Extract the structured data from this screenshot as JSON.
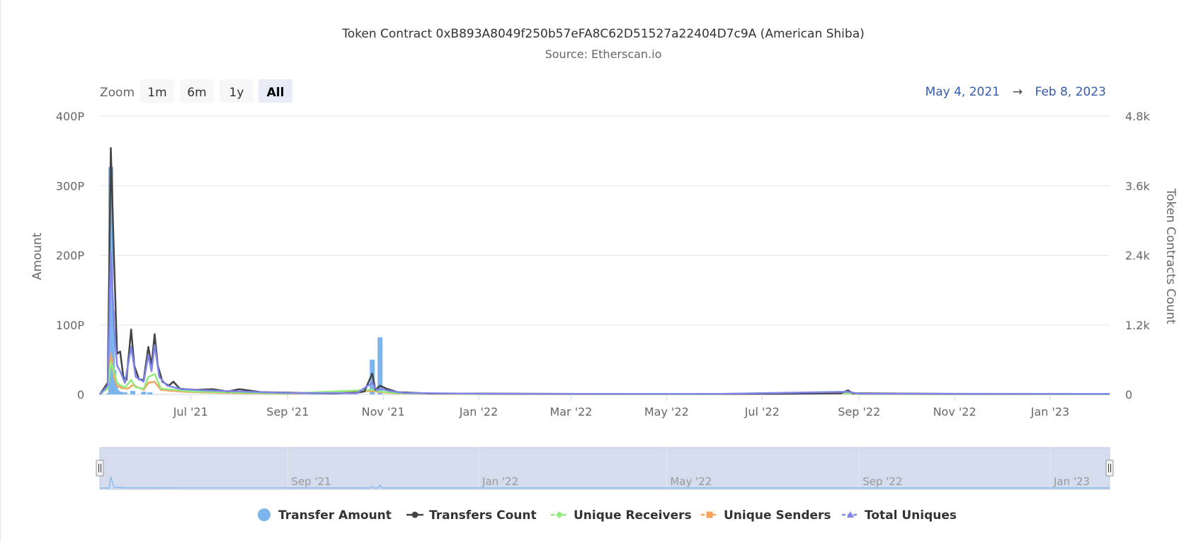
{
  "header": {
    "title": "Token Contract 0xB893A8049f250b57eFA8C62D51527a22404D7c9A (American Shiba)",
    "subtitle": "Source: Etherscan.io"
  },
  "zoom": {
    "label": "Zoom",
    "buttons": [
      "1m",
      "6m",
      "1y",
      "All"
    ],
    "selected": "All"
  },
  "range": {
    "from": "May 4, 2021",
    "arrow": "→",
    "to": "Feb 8, 2023"
  },
  "navigator": {
    "labels": [
      "Sep '21",
      "Jan '22",
      "May '22",
      "Sep '22",
      "Jan '23"
    ]
  },
  "chart_data": {
    "type": "line",
    "title": "Token Contract 0xB893A8049f250b57eFA8C62D51527a22404D7c9A (American Shiba)",
    "subtitle": "Source: Etherscan.io",
    "x_range": [
      "2021-05-04",
      "2023-02-08"
    ],
    "x_ticks": [
      "Jul '21",
      "Sep '21",
      "Nov '21",
      "Jan '22",
      "Mar '22",
      "May '22",
      "Jul '22",
      "Sep '22",
      "Nov '22",
      "Jan '23"
    ],
    "y_left": {
      "label": "Amount",
      "ticks": [
        "0",
        "100P",
        "200P",
        "300P",
        "400P"
      ],
      "range": [
        0,
        400
      ]
    },
    "y_right": {
      "label": "Token Contracts Count",
      "ticks": [
        "0",
        "1.2k",
        "2.4k",
        "3.6k",
        "4.8k"
      ],
      "range": [
        0,
        4800
      ]
    },
    "grid": true,
    "legend_position": "bottom",
    "series": [
      {
        "name": "Transfer Amount",
        "type": "column",
        "axis": "left",
        "color": "#7cb5ec",
        "points": [
          [
            "2021-05-10",
            2
          ],
          [
            "2021-05-11",
            327
          ],
          [
            "2021-05-12",
            120
          ],
          [
            "2021-05-13",
            35
          ],
          [
            "2021-05-14",
            12
          ],
          [
            "2021-05-15",
            6
          ],
          [
            "2021-05-17",
            4
          ],
          [
            "2021-05-20",
            3
          ],
          [
            "2021-05-25",
            5
          ],
          [
            "2021-06-01",
            4
          ],
          [
            "2021-06-05",
            3
          ],
          [
            "2021-10-25",
            50
          ],
          [
            "2021-10-30",
            82
          ]
        ]
      },
      {
        "name": "Transfers Count",
        "type": "line",
        "axis": "right",
        "color": "#434348",
        "points": [
          [
            "2021-05-04",
            0
          ],
          [
            "2021-05-09",
            200
          ],
          [
            "2021-05-11",
            4250
          ],
          [
            "2021-05-13",
            2400
          ],
          [
            "2021-05-15",
            700
          ],
          [
            "2021-05-17",
            740
          ],
          [
            "2021-05-19",
            300
          ],
          [
            "2021-05-21",
            250
          ],
          [
            "2021-05-24",
            1120
          ],
          [
            "2021-05-26",
            500
          ],
          [
            "2021-05-29",
            260
          ],
          [
            "2021-06-01",
            250
          ],
          [
            "2021-06-04",
            820
          ],
          [
            "2021-06-06",
            500
          ],
          [
            "2021-06-08",
            1040
          ],
          [
            "2021-06-10",
            500
          ],
          [
            "2021-06-13",
            220
          ],
          [
            "2021-06-17",
            150
          ],
          [
            "2021-06-20",
            220
          ],
          [
            "2021-06-24",
            100
          ],
          [
            "2021-06-28",
            90
          ],
          [
            "2021-07-05",
            80
          ],
          [
            "2021-07-15",
            90
          ],
          [
            "2021-07-25",
            50
          ],
          [
            "2021-08-01",
            90
          ],
          [
            "2021-08-15",
            40
          ],
          [
            "2021-09-01",
            30
          ],
          [
            "2021-09-15",
            20
          ],
          [
            "2021-10-01",
            15
          ],
          [
            "2021-10-15",
            30
          ],
          [
            "2021-10-20",
            50
          ],
          [
            "2021-10-25",
            360
          ],
          [
            "2021-10-27",
            80
          ],
          [
            "2021-10-30",
            150
          ],
          [
            "2021-11-03",
            100
          ],
          [
            "2021-11-10",
            40
          ],
          [
            "2021-12-01",
            15
          ],
          [
            "2022-01-01",
            15
          ],
          [
            "2022-03-01",
            10
          ],
          [
            "2022-05-01",
            10
          ],
          [
            "2022-07-01",
            10
          ],
          [
            "2022-08-20",
            20
          ],
          [
            "2022-08-25",
            70
          ],
          [
            "2022-08-28",
            20
          ],
          [
            "2022-11-01",
            10
          ],
          [
            "2023-01-01",
            10
          ],
          [
            "2023-02-08",
            10
          ]
        ]
      },
      {
        "name": "Unique Receivers",
        "type": "line",
        "axis": "right",
        "color": "#90ed7d",
        "points": [
          [
            "2021-05-04",
            0
          ],
          [
            "2021-05-09",
            100
          ],
          [
            "2021-05-11",
            560
          ],
          [
            "2021-05-13",
            400
          ],
          [
            "2021-05-15",
            200
          ],
          [
            "2021-05-17",
            160
          ],
          [
            "2021-05-20",
            120
          ],
          [
            "2021-05-24",
            250
          ],
          [
            "2021-05-27",
            120
          ],
          [
            "2021-06-01",
            100
          ],
          [
            "2021-06-04",
            300
          ],
          [
            "2021-06-08",
            350
          ],
          [
            "2021-06-12",
            100
          ],
          [
            "2021-06-20",
            80
          ],
          [
            "2021-07-01",
            50
          ],
          [
            "2021-08-01",
            30
          ],
          [
            "2021-09-01",
            15
          ],
          [
            "2021-10-25",
            80
          ],
          [
            "2021-10-30",
            50
          ],
          [
            "2021-11-10",
            20
          ],
          [
            "2022-01-01",
            8
          ],
          [
            "2022-06-01",
            5
          ],
          [
            "2022-08-25",
            25
          ],
          [
            "2022-09-01",
            8
          ],
          [
            "2023-02-08",
            5
          ]
        ]
      },
      {
        "name": "Unique Senders",
        "type": "line",
        "axis": "right",
        "color": "#f7a35c",
        "points": [
          [
            "2021-05-04",
            0
          ],
          [
            "2021-05-09",
            120
          ],
          [
            "2021-05-11",
            700
          ],
          [
            "2021-05-13",
            300
          ],
          [
            "2021-05-15",
            150
          ],
          [
            "2021-05-18",
            110
          ],
          [
            "2021-05-22",
            100
          ],
          [
            "2021-05-25",
            160
          ],
          [
            "2021-06-01",
            80
          ],
          [
            "2021-06-04",
            200
          ],
          [
            "2021-06-08",
            220
          ],
          [
            "2021-06-12",
            80
          ],
          [
            "2021-06-20",
            60
          ],
          [
            "2021-07-01",
            40
          ],
          [
            "2021-08-01",
            20
          ],
          [
            "2021-09-01",
            10
          ],
          [
            "2021-10-25",
            60
          ],
          [
            "2021-10-30",
            40
          ],
          [
            "2021-11-10",
            15
          ],
          [
            "2022-01-01",
            6
          ],
          [
            "2022-06-01",
            4
          ],
          [
            "2022-08-25",
            20
          ],
          [
            "2022-09-01",
            6
          ],
          [
            "2023-02-08",
            4
          ]
        ]
      },
      {
        "name": "Total Uniques",
        "type": "line",
        "axis": "right",
        "color": "#8085e9",
        "points": [
          [
            "2021-05-04",
            0
          ],
          [
            "2021-05-09",
            150
          ],
          [
            "2021-05-11",
            2450
          ],
          [
            "2021-05-13",
            1200
          ],
          [
            "2021-05-15",
            500
          ],
          [
            "2021-05-17",
            400
          ],
          [
            "2021-05-20",
            200
          ],
          [
            "2021-05-24",
            820
          ],
          [
            "2021-05-27",
            300
          ],
          [
            "2021-06-01",
            220
          ],
          [
            "2021-06-04",
            680
          ],
          [
            "2021-06-06",
            400
          ],
          [
            "2021-06-08",
            850
          ],
          [
            "2021-06-11",
            300
          ],
          [
            "2021-06-16",
            150
          ],
          [
            "2021-06-25",
            90
          ],
          [
            "2021-07-10",
            70
          ],
          [
            "2021-08-01",
            50
          ],
          [
            "2021-09-01",
            25
          ],
          [
            "2021-10-15",
            20
          ],
          [
            "2021-10-25",
            200
          ],
          [
            "2021-10-28",
            70
          ],
          [
            "2021-10-30",
            100
          ],
          [
            "2021-11-05",
            60
          ],
          [
            "2021-11-15",
            25
          ],
          [
            "2022-01-01",
            12
          ],
          [
            "2022-06-01",
            8
          ],
          [
            "2022-08-25",
            45
          ],
          [
            "2022-09-01",
            12
          ],
          [
            "2023-02-08",
            8
          ]
        ]
      }
    ]
  },
  "legend": [
    {
      "label": "Transfer Amount",
      "symbol": "circle",
      "color": "#7cb5ec"
    },
    {
      "label": "Transfers Count",
      "symbol": "circle-line",
      "color": "#434348"
    },
    {
      "label": "Unique Receivers",
      "symbol": "diamond-line",
      "color": "#90ed7d"
    },
    {
      "label": "Unique Senders",
      "symbol": "square-line",
      "color": "#f7a35c"
    },
    {
      "label": "Total Uniques",
      "symbol": "triangle-line",
      "color": "#8085e9"
    }
  ]
}
